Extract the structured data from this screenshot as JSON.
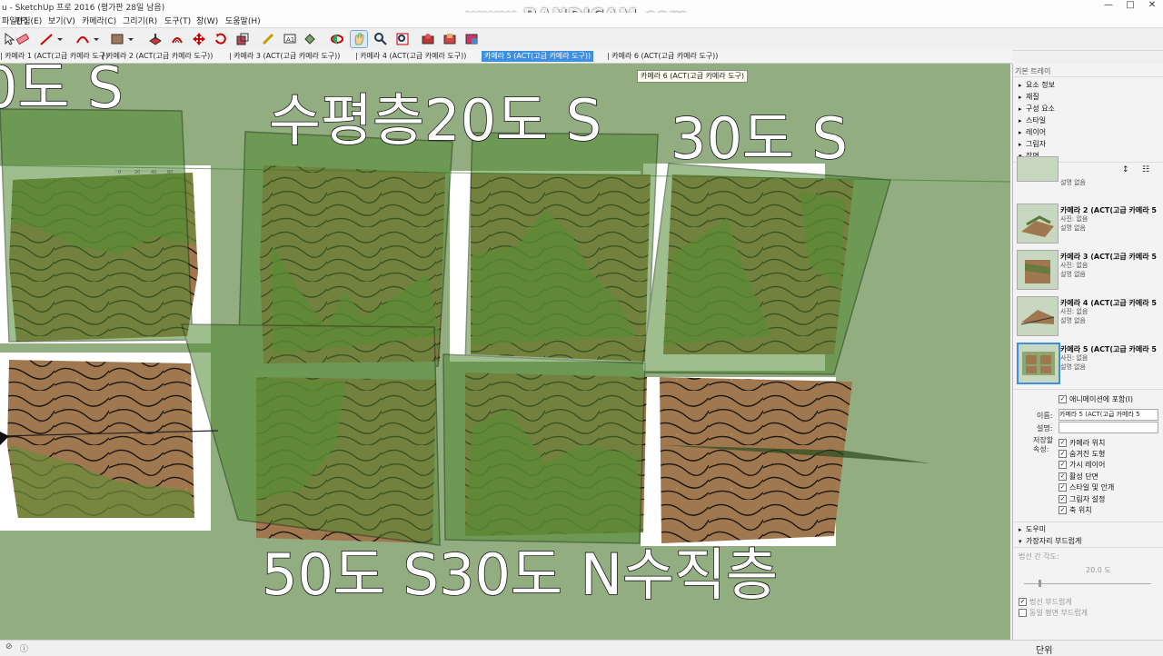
{
  "window": {
    "title": "u - SketchUp 프로 2016 (평가판 28일 남음)",
    "watermark": "www.BANDICAM.com",
    "min": "—",
    "max": "□",
    "close": "✕"
  },
  "menu": [
    "파일(F)",
    "편집(E)",
    "보기(V)",
    "카메라(C)",
    "그리기(R)",
    "도구(T)",
    "창(W)",
    "도움말(H)"
  ],
  "scene_tabs": [
    "| 카메라 1 (ACT(고급 카메라 도구)",
    "| 카메라 2 (ACT(고급 카메라 도구))",
    "| 카메라 3 (ACT(고급 카메라 도구))",
    "| 카메라 4 (ACT(고급 카메라 도구))",
    "카메라 5 (ACT(고급 카메라 도구))",
    "| 카메라 6 (ACT(고급 카메라 도구))"
  ],
  "selected_tab_index": 4,
  "tooltip": "카메라 6 (ACT(고급 카메라 도구)",
  "viewport": {
    "labels": {
      "top_left": "0도 S",
      "top_mid1": "수평층20도 S",
      "top_mid2": "30도 S",
      "bottom": "50도 S30도 N수직층"
    },
    "ruler_ticks": [
      "0",
      "20",
      "40",
      "60"
    ],
    "background": "#92ad80"
  },
  "tray": {
    "title": "기본 트레이",
    "sections_top": [
      {
        "label": "요소 정보",
        "expanded": false
      },
      {
        "label": "재질",
        "expanded": false
      },
      {
        "label": "구성 요소",
        "expanded": false
      },
      {
        "label": "스타일",
        "expanded": false
      },
      {
        "label": "레이어",
        "expanded": false
      },
      {
        "label": "그림자",
        "expanded": false
      },
      {
        "label": "장면",
        "expanded": true
      }
    ],
    "scenes": [
      {
        "name": "",
        "photo": "",
        "desc": "설명 없음"
      },
      {
        "name": "카메라 2 (ACT(고급 카메라 5",
        "photo": "사진: 없음",
        "desc": "설명 없음"
      },
      {
        "name": "카메라 3 (ACT(고급 카메라 5",
        "photo": "사진: 없음",
        "desc": "설명 없음"
      },
      {
        "name": "카메라 4 (ACT(고급 카메라 5",
        "photo": "사진: 없음",
        "desc": "설명 없음"
      },
      {
        "name": "카메라 5 (ACT(고급 카메라 5",
        "photo": "사진: 없음",
        "desc": "설명 없음"
      }
    ],
    "scene_props": {
      "include_anim": "애니메이션에 포함(I)",
      "name_label": "이름:",
      "name_value": "카메라 5 (ACT(고급 카메라 5",
      "desc_label": "설명:",
      "desc_value": "",
      "save_label": "저장할 속성:",
      "props": [
        "카메라 위치",
        "숨겨진 도형",
        "가시 레이어",
        "활성 단면",
        "스타일 및 안개",
        "그림자 설정",
        "축 위치"
      ]
    },
    "sections_bottom": [
      {
        "label": "도우미",
        "expanded": false
      },
      {
        "label": "가장자리 부드럽게",
        "expanded": true
      }
    ],
    "soften": {
      "angle_label": "법선 간 각도:",
      "angle_value": "20.0  도",
      "opt1": "법선 부드럽게",
      "opt2": "동일 평면 부드럽게"
    }
  },
  "status": {
    "right": "단위"
  }
}
